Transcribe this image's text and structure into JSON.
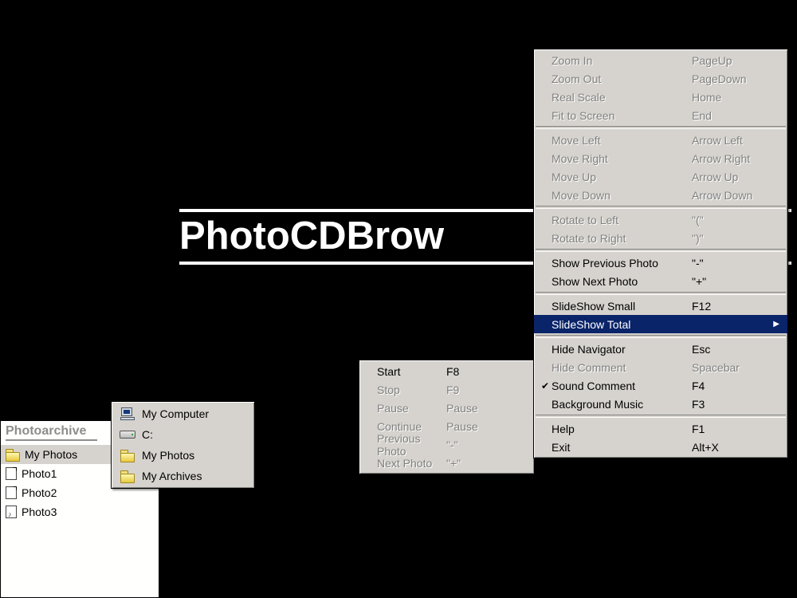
{
  "title_text": "PhotoCDBrow",
  "navigator": {
    "title": "Photoarchive",
    "items": [
      {
        "label": "My Photos",
        "icon": "folder",
        "selected": true
      },
      {
        "label": "Photo1",
        "icon": "page",
        "selected": false
      },
      {
        "label": "Photo2",
        "icon": "page",
        "selected": false
      },
      {
        "label": "Photo3",
        "icon": "audio",
        "selected": false
      }
    ]
  },
  "dropdown": {
    "items": [
      {
        "label": "My Computer",
        "icon": "computer"
      },
      {
        "label": "C:",
        "icon": "drive"
      },
      {
        "label": "My Photos",
        "icon": "folder"
      },
      {
        "label": "My Archives",
        "icon": "folder"
      }
    ]
  },
  "main_menu": {
    "sections": [
      [
        {
          "label": "Zoom In",
          "accel": "PageUp",
          "state": "disabled"
        },
        {
          "label": "Zoom Out",
          "accel": "PageDown",
          "state": "disabled"
        },
        {
          "label": "Real Scale",
          "accel": "Home",
          "state": "disabled"
        },
        {
          "label": "Fit to Screen",
          "accel": "End",
          "state": "disabled"
        }
      ],
      [
        {
          "label": "Move Left",
          "accel": "Arrow Left",
          "state": "disabled"
        },
        {
          "label": "Move Right",
          "accel": "Arrow Right",
          "state": "disabled"
        },
        {
          "label": "Move Up",
          "accel": "Arrow Up",
          "state": "disabled"
        },
        {
          "label": "Move Down",
          "accel": "Arrow Down",
          "state": "disabled"
        }
      ],
      [
        {
          "label": "Rotate to Left",
          "accel": "\"(\"",
          "state": "disabled"
        },
        {
          "label": "Rotate to Right",
          "accel": "\")\"",
          "state": "disabled"
        }
      ],
      [
        {
          "label": "Show Previous Photo",
          "accel": "\"-\"",
          "state": "enabled"
        },
        {
          "label": "Show Next Photo",
          "accel": "\"+\"",
          "state": "enabled"
        }
      ],
      [
        {
          "label": "SlideShow Small",
          "accel": "F12",
          "state": "enabled"
        },
        {
          "label": "SlideShow Total",
          "accel": "",
          "state": "enabled",
          "highlight": true,
          "submenu": true
        }
      ],
      [
        {
          "label": "Hide Navigator",
          "accel": "Esc",
          "state": "enabled"
        },
        {
          "label": "Hide Comment",
          "accel": "Spacebar",
          "state": "disabled"
        },
        {
          "label": "Sound Comment",
          "accel": "F4",
          "state": "enabled",
          "checked": true
        },
        {
          "label": "Background Music",
          "accel": "F3",
          "state": "enabled"
        }
      ],
      [
        {
          "label": "Help",
          "accel": "F1",
          "state": "enabled"
        },
        {
          "label": "Exit",
          "accel": "Alt+X",
          "state": "enabled"
        }
      ]
    ]
  },
  "sub_menu": {
    "items": [
      {
        "label": "Start",
        "accel": "F8",
        "state": "enabled"
      },
      {
        "label": "Stop",
        "accel": "F9",
        "state": "disabled"
      },
      {
        "label": "Pause",
        "accel": "Pause",
        "state": "disabled"
      },
      {
        "label": "Continue",
        "accel": "Pause",
        "state": "disabled"
      },
      {
        "label": "Previous Photo",
        "accel": "\"-\"",
        "state": "disabled"
      },
      {
        "label": "Next Photo",
        "accel": "\"+\"",
        "state": "disabled"
      }
    ]
  }
}
